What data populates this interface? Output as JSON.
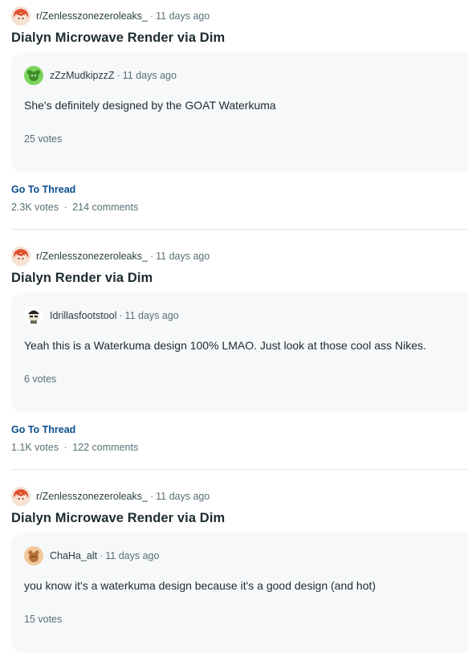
{
  "posts": [
    {
      "subreddit": "r/Zenlesszonezeroleaks_",
      "age": "11 days ago",
      "title": "Dialyn Microwave Render via Dim",
      "comment": {
        "username": "zZzMudkipzzZ",
        "age": "11 days ago",
        "body": "She's definitely designed by the GOAT Waterkuma",
        "votes": "25 votes",
        "avatar_color": "#7bd35a"
      },
      "go_to_thread": "Go To Thread",
      "votes": "2.3K votes",
      "comments": "214 comments"
    },
    {
      "subreddit": "r/Zenlesszonezeroleaks_",
      "age": "11 days ago",
      "title": "Dialyn Render via Dim",
      "comment": {
        "username": "Idrillasfootstool",
        "age": "11 days ago",
        "body": "Yeah this is a Waterkuma design 100% LMAO. Just look at those cool ass Nikes.",
        "votes": "6 votes",
        "avatar_color": "#d8d8c8"
      },
      "go_to_thread": "Go To Thread",
      "votes": "1.1K votes",
      "comments": "122 comments"
    },
    {
      "subreddit": "r/Zenlesszonezeroleaks_",
      "age": "11 days ago",
      "title": "Dialyn Microwave Render via Dim",
      "comment": {
        "username": "ChaHa_alt",
        "age": "11 days ago",
        "body": "you know it's a waterkuma design because it's a good design (and hot)",
        "votes": "15 votes",
        "avatar_color": "#e8a86a"
      },
      "go_to_thread": "Go To Thread",
      "votes": "",
      "comments": ""
    }
  ],
  "separator": "·"
}
